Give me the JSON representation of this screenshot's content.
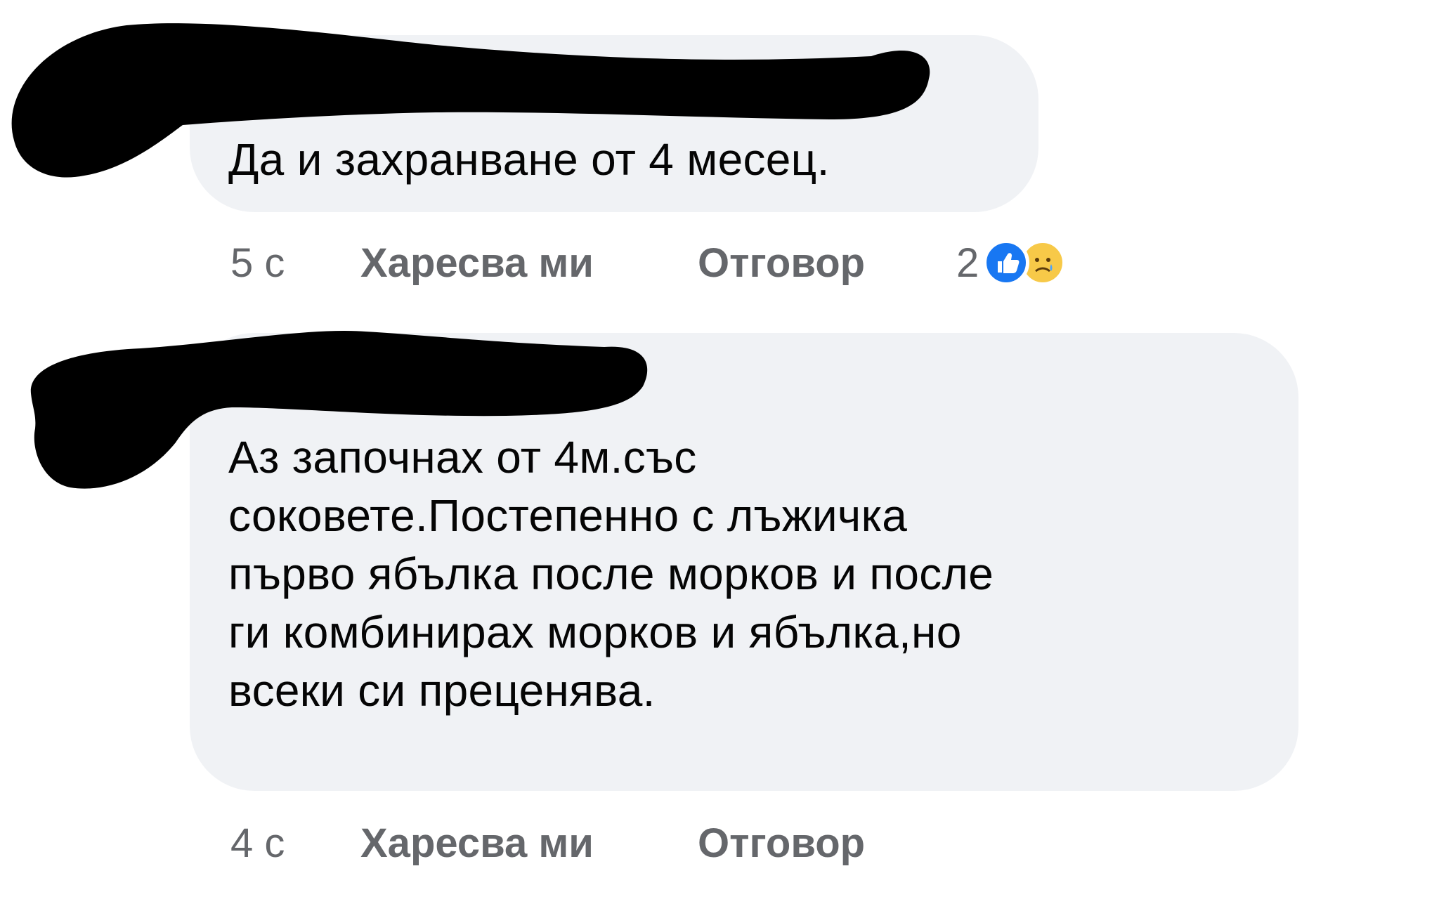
{
  "comments": [
    {
      "text": "Да и захранване от 4 месец.",
      "time": "5 с",
      "like_label": "Харесва ми",
      "reply_label": "Отговор",
      "reaction_count": "2",
      "reactions": [
        "like-icon",
        "sad-icon"
      ]
    },
    {
      "text": "Аз започнах от 4м.със\nсоковете.Постепенно с лъжичка\nпърво ябълка после морков и после\nги комбинирах морков и ябълка,но\nвсеки си преценява.",
      "time": "4 с",
      "like_label": "Харесва ми",
      "reply_label": "Отговор"
    }
  ],
  "colors": {
    "bubble_bg": "#f0f2f5",
    "text": "#050505",
    "meta_text": "#65676b",
    "like_blue": "#1877f2",
    "sad_yellow": "#f7c948",
    "redaction": "#000000"
  }
}
